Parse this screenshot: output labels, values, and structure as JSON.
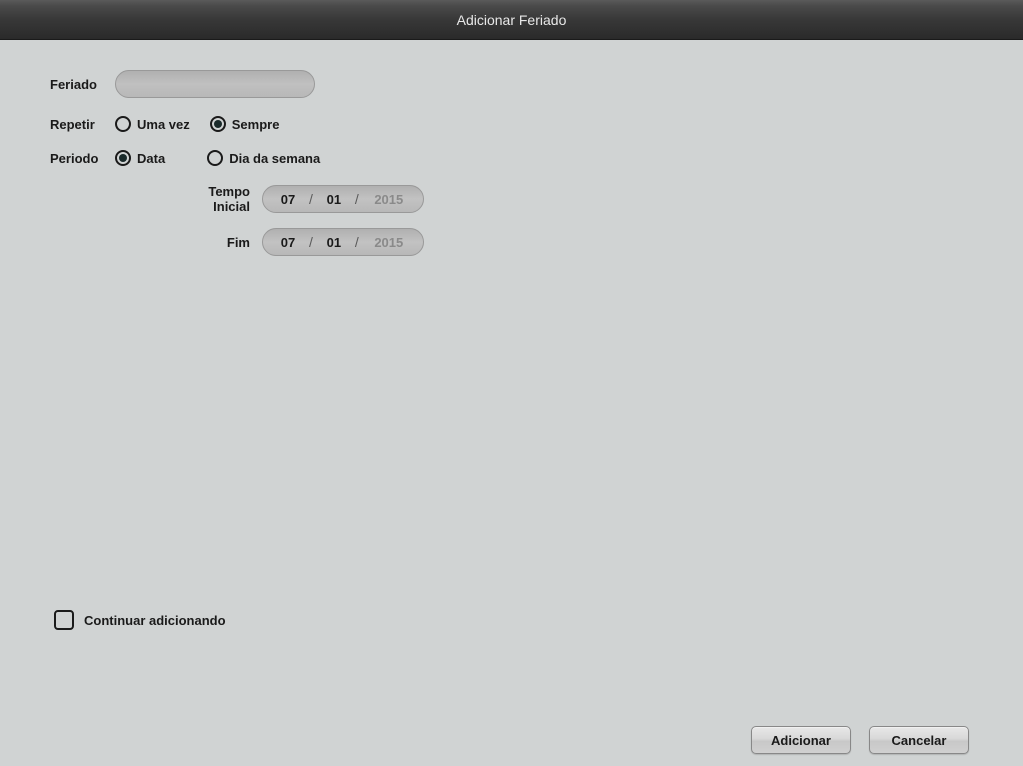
{
  "title": "Adicionar Feriado",
  "labels": {
    "holiday": "Feriado",
    "repeat": "Repetir",
    "period": "Periodo",
    "startTime": "Tempo Inicial",
    "endTime": "Fim",
    "continueAdding": "Continuar adicionando"
  },
  "repeat_options": {
    "once": "Uma vez",
    "always": "Sempre"
  },
  "period_options": {
    "date": "Data",
    "weekday": "Dia da semana"
  },
  "holiday_name": "",
  "repeat_selected": "always",
  "period_selected": "date",
  "start_date": {
    "day": "07",
    "month": "01",
    "year": "2015"
  },
  "end_date": {
    "day": "07",
    "month": "01",
    "year": "2015"
  },
  "continue_adding_checked": false,
  "buttons": {
    "add": "Adicionar",
    "cancel": "Cancelar"
  }
}
